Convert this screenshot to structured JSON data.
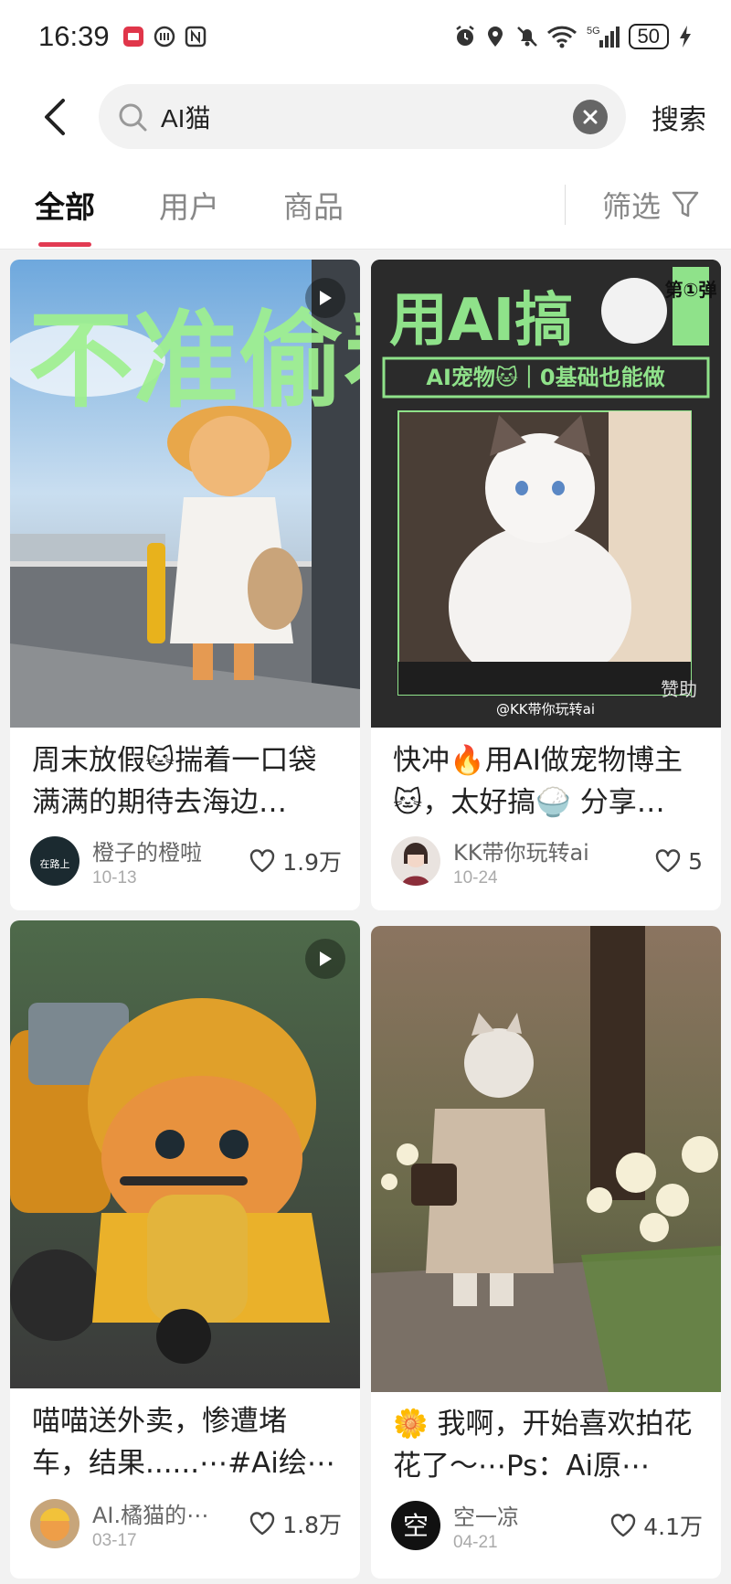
{
  "status_bar": {
    "time": "16:39",
    "battery": "50",
    "network": "5G"
  },
  "search": {
    "query": "AI猫",
    "search_button": "搜索"
  },
  "tabs": [
    {
      "label": "全部",
      "active": true
    },
    {
      "label": "用户",
      "active": false
    },
    {
      "label": "商品",
      "active": false
    }
  ],
  "filter_label": "筛选",
  "cards": [
    {
      "title": "周末放假🐱揣着一口袋满满的期待去海边…",
      "image_text": "不准偷看",
      "author": "橙子的橙啦",
      "date": "10-13",
      "likes": "1.9万",
      "has_video": true,
      "avatar_text": "在路上"
    },
    {
      "title": "快冲🔥用AI做宠物博主🐱，太好搞🍚 分享…",
      "image_text": "用AI搞",
      "image_badge": "第①弹",
      "image_sub": "AI宠物🐱｜0基础也能做",
      "image_watermark": "@KK带你玩转ai",
      "sponsor": "赞助",
      "author": "KK带你玩转ai",
      "date": "10-24",
      "likes": "5",
      "has_video": false
    },
    {
      "title": "喵喵送外卖，惨遭堵车，结果......⋯#Ai绘⋯",
      "author": "AI.橘猫的⋯",
      "date": "03-17",
      "likes": "1.8万",
      "has_video": true
    },
    {
      "title": "🌼 我啊，开始喜欢拍花花了～⋯Ps：Ai原⋯",
      "author": "空一凉",
      "date": "04-21",
      "likes": "4.1万",
      "has_video": false,
      "avatar_text": "空"
    }
  ]
}
